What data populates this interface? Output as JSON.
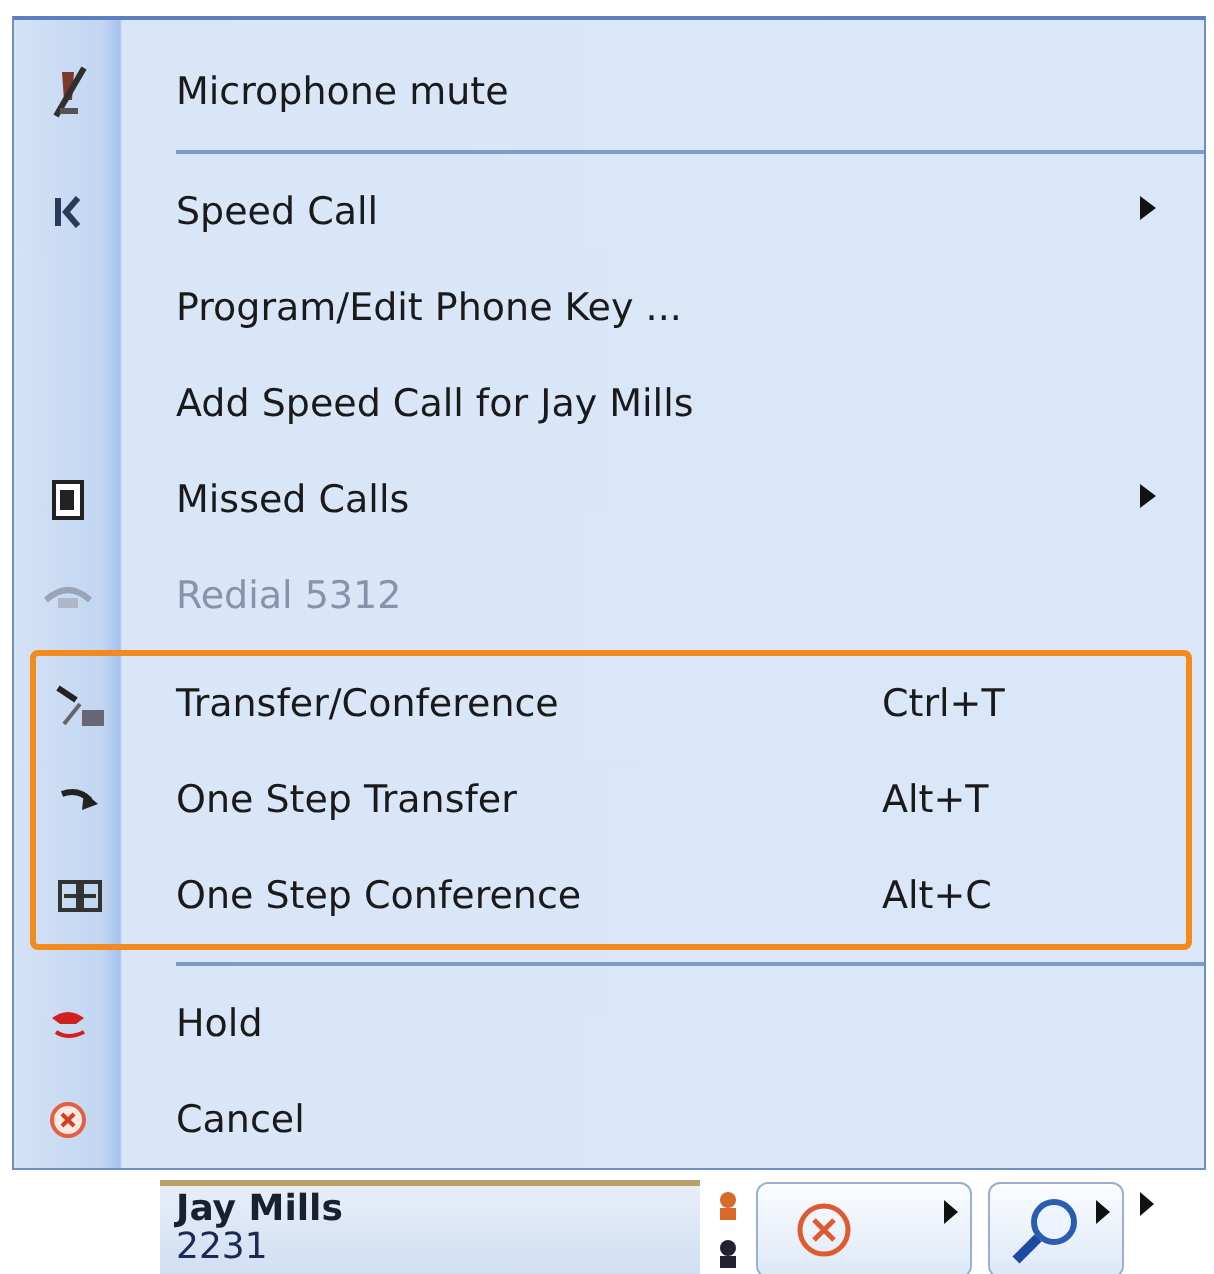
{
  "menu": {
    "items": [
      {
        "kind": "item",
        "label": "Microphone mute",
        "disabled": false,
        "highlighted": false
      },
      {
        "kind": "separator"
      },
      {
        "kind": "item",
        "label": "Speed Call",
        "submenu": true,
        "disabled": false,
        "highlighted": false
      },
      {
        "kind": "item",
        "label": "Program/Edit Phone Key ...",
        "disabled": false,
        "highlighted": false
      },
      {
        "kind": "item",
        "label": "Add Speed Call for Jay Mills",
        "disabled": false,
        "highlighted": false
      },
      {
        "kind": "item",
        "label": "Missed Calls",
        "submenu": true,
        "disabled": false,
        "highlighted": false
      },
      {
        "kind": "item",
        "label": "Redial 5312",
        "disabled": true,
        "highlighted": false
      },
      {
        "kind": "item",
        "label": "Transfer/Conference",
        "shortcut": "Ctrl+T",
        "disabled": false,
        "highlighted": true
      },
      {
        "kind": "item",
        "label": "One Step Transfer",
        "shortcut": "Alt+T",
        "disabled": false,
        "highlighted": true
      },
      {
        "kind": "item",
        "label": "One Step Conference",
        "shortcut": "Alt+C",
        "disabled": false,
        "highlighted": true
      },
      {
        "kind": "separator"
      },
      {
        "kind": "item",
        "label": "Hold",
        "disabled": false,
        "highlighted": false
      },
      {
        "kind": "item",
        "label": "Cancel",
        "disabled": false,
        "highlighted": false
      }
    ]
  },
  "call_bar": {
    "name": "Jay Mills",
    "number": "2231"
  }
}
